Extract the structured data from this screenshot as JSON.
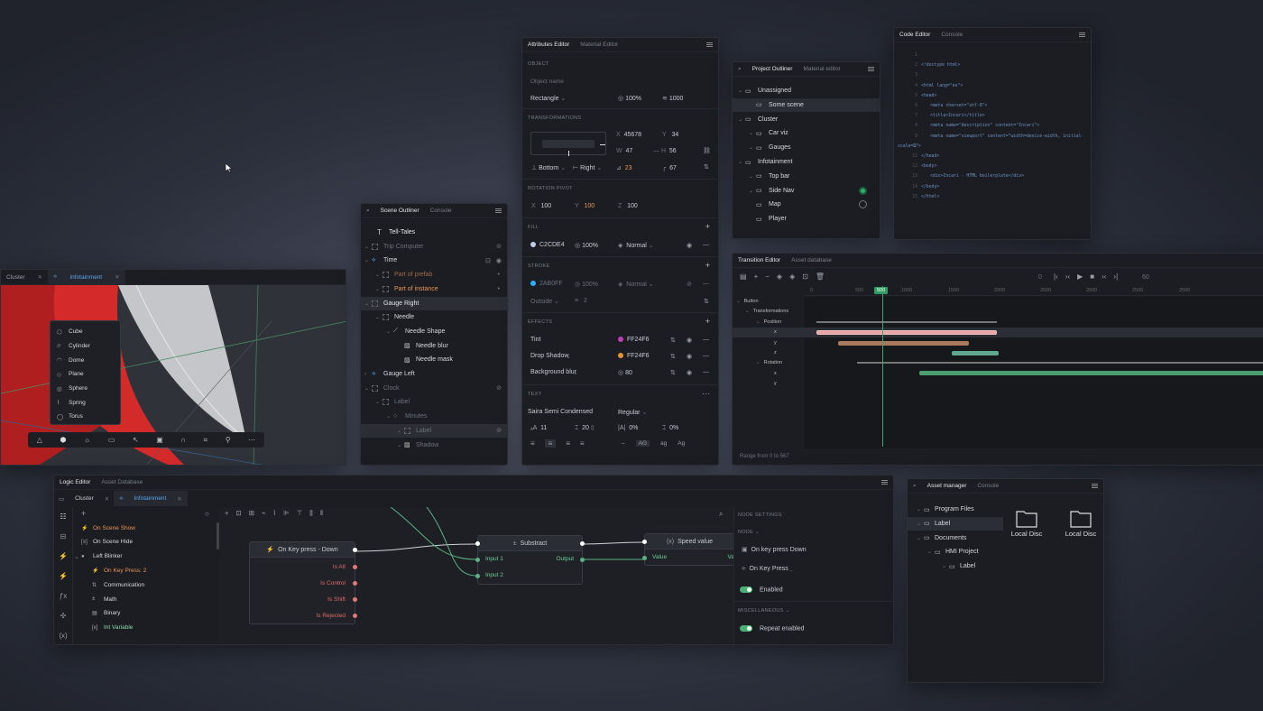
{
  "viewport": {
    "tabs": [
      "Cluster",
      "Infotainment"
    ],
    "menu": [
      {
        "label": "Cube",
        "icon": "cube-icon"
      },
      {
        "label": "Cylinder",
        "icon": "cylinder-icon"
      },
      {
        "label": "Dome",
        "icon": "dome-icon"
      },
      {
        "label": "Plane",
        "icon": "plane-icon"
      },
      {
        "label": "Sphere",
        "icon": "sphere-icon"
      },
      {
        "label": "Spring",
        "icon": "spring-icon"
      },
      {
        "label": "Torus",
        "icon": "torus-icon"
      }
    ]
  },
  "scene": {
    "tabs": [
      "Scene Outliner",
      "Console"
    ],
    "items": [
      {
        "label": "Tell-Tales",
        "type": "text"
      },
      {
        "label": "Trip Computer",
        "type": "dim"
      },
      {
        "label": "Time",
        "type": "normal"
      },
      {
        "label": "Part of prefab",
        "type": "orange-dim"
      },
      {
        "label": "Part of instance",
        "type": "orange"
      },
      {
        "label": "Gauge Right",
        "type": "sel"
      },
      {
        "label": "Needle",
        "type": "normal"
      },
      {
        "label": "Needle Shape",
        "type": "normal"
      },
      {
        "label": "Needle blur",
        "type": "normal"
      },
      {
        "label": "Needle mask",
        "type": "normal"
      },
      {
        "label": "Gauge Left",
        "type": "normal"
      },
      {
        "label": "Clock",
        "type": "dim"
      },
      {
        "label": "Label",
        "type": "dim"
      },
      {
        "label": "Minutes",
        "type": "dim"
      },
      {
        "label": "Label",
        "type": "dim-sel"
      },
      {
        "label": "Shadow",
        "type": "dim"
      }
    ]
  },
  "attributes": {
    "tabs": [
      "Attributes Editor",
      "Material Editor"
    ],
    "sections": {
      "object": "OBJECT",
      "transformations": "TRANSFORMATIONS",
      "rotation": "ROTATION PIVOT",
      "fill": "FILL",
      "stroke": "STROKE",
      "effects": "EFFECTS",
      "text": "TEXT"
    },
    "object_name_placeholder": "Object name",
    "shape": "Rectangle",
    "opacity": "100%",
    "layer": "1000",
    "x_label": "X",
    "x": "45678",
    "y_label": "Y",
    "y": "34",
    "w_label": "W",
    "w": "47",
    "h_label": "H",
    "h": "56",
    "anchor_v": "Bottom",
    "anchor_h": "Right",
    "angle": "23",
    "radius": "67",
    "rot_x": "100",
    "rot_y": "100",
    "rot_z": "100",
    "fill_hex": "C2CDE4",
    "fill_opacity": "100%",
    "fill_blend": "Normal",
    "stroke_hex": "2AB0FF",
    "stroke_opacity": "100%",
    "stroke_blend": "Normal",
    "stroke_pos": "Outside",
    "stroke_w": "2",
    "effects": [
      {
        "label": "Tint",
        "hex": "FF24F6",
        "color": "#c23bb8"
      },
      {
        "label": "Drop Shadow",
        "hex": "FF24F6",
        "color": "#e6932f"
      },
      {
        "label": "Background blur",
        "hex": "80",
        "color": ""
      }
    ],
    "font": "Saira Semi Condensed",
    "weight": "Regular",
    "size": "11",
    "lh": "20",
    "ls": "0%",
    "ps": "0%",
    "case": [
      "–",
      "AG",
      "ag",
      "Ag"
    ]
  },
  "project": {
    "tabs": [
      "Project Outliner",
      "Material editor"
    ],
    "items": [
      "Unassigned",
      "Some scene",
      "Cluster",
      "Car viz",
      "Gauges",
      "Infotainment",
      "Top bar",
      "Side Nav",
      "Map",
      "Player"
    ]
  },
  "code": {
    "tabs": [
      "Code Editor",
      "Console"
    ],
    "lines": [
      "",
      "<!doctype html>",
      "",
      "<html lang=\"en\">",
      "<head>",
      "<meta charset=\"utf-8\">",
      "<title>Incari</title>",
      "<meta name=\"description\" content=\"Incari\">",
      "<meta name=\"viewport\" content=\"width=device-width, initial-",
      "scale=1\">",
      "</head>",
      "<body>",
      "<div>Incari - HTML boilerplate</div>",
      "</body>",
      "</html>"
    ]
  },
  "transition": {
    "tabs": [
      "Transition Editor",
      "Asset database"
    ],
    "frame": "0",
    "fps": "60",
    "playhead": "500",
    "ticks": [
      "0",
      "500",
      "1000",
      "1500",
      "2000",
      "2500",
      "2500",
      "2500",
      "2500"
    ],
    "tracks": [
      "Button",
      "Transformations",
      "Position",
      "x",
      "y",
      "z",
      "Rotation",
      "x",
      "y"
    ],
    "footer": "Range from 0 to 567"
  },
  "logic": {
    "tabs": [
      "Logic Editor",
      "Asset Database"
    ],
    "doc_tabs": [
      "Cluster",
      "Infotainment"
    ],
    "list": [
      {
        "label": "On Scene Show",
        "c": "orange"
      },
      {
        "label": "On Scene Hide",
        "c": ""
      },
      {
        "label": "Left Blinker",
        "c": ""
      },
      {
        "label": "On Key Press: 2",
        "c": "orange"
      },
      {
        "label": "Communication",
        "c": ""
      },
      {
        "label": "Math",
        "c": ""
      },
      {
        "label": "Binary",
        "c": ""
      },
      {
        "label": "Int Variable",
        "c": "green"
      }
    ],
    "node_key": {
      "title": "On Key press - Down",
      "ports": [
        "Is Alt",
        "Is Control",
        "Is Shift",
        "Is Rejected"
      ]
    },
    "node_sub": {
      "title": "Substract",
      "in": [
        "Input 1",
        "Input 2"
      ],
      "out": "Output"
    },
    "node_speed": {
      "title": "Speed value",
      "in": "Value",
      "out": "Va"
    },
    "settings": {
      "title": "NODE SETTINGS",
      "node": "NODE",
      "event": "On key press Down",
      "trigger": "On Key Press",
      "enabled": "Enabled",
      "misc": "MISCELLANEOUS",
      "repeat": "Repeat enabled"
    }
  },
  "assets": {
    "tabs": [
      "Asset manager",
      "Console"
    ],
    "tree": [
      "Program Files",
      "Label",
      "Documents",
      "HMI Project",
      "Label"
    ],
    "folders": [
      "Local Disc",
      "Local Disc"
    ]
  }
}
